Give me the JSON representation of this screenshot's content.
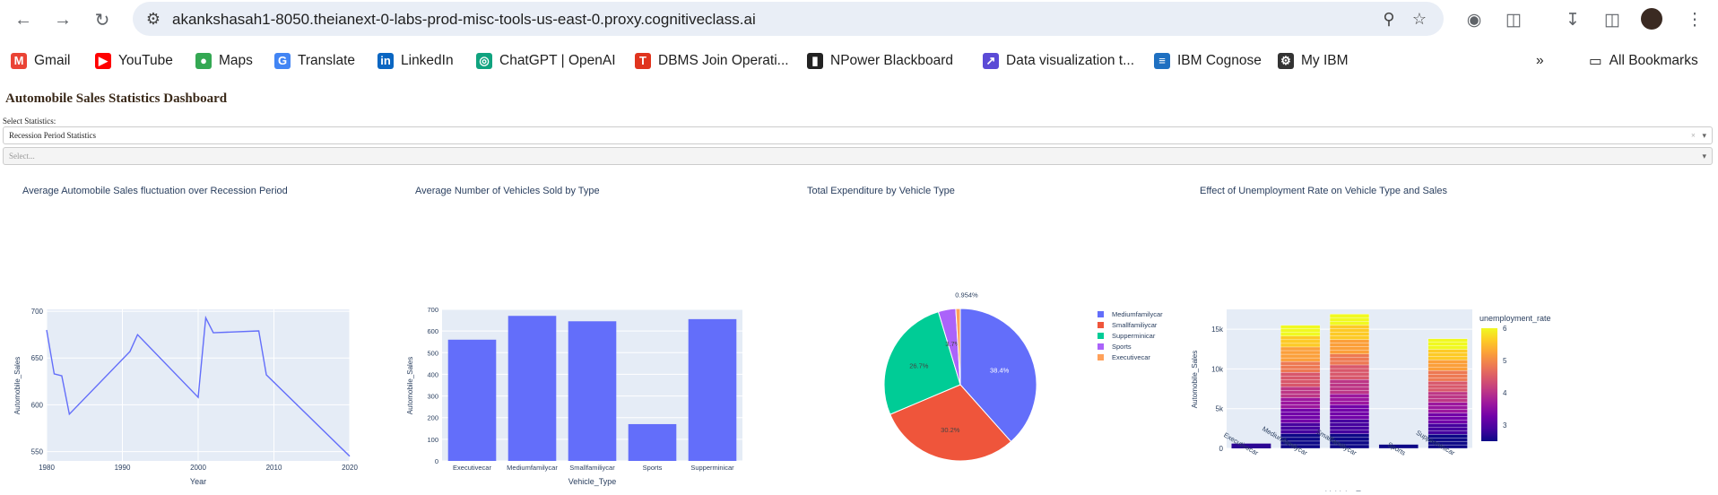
{
  "browser": {
    "url": "akankshasah1-8050.theianext-0-labs-prod-misc-tools-us-east-0.proxy.cognitiveclass.ai",
    "bookmarks": [
      {
        "label": "Gmail",
        "icon": "gmail-icon",
        "color": "#ea4335"
      },
      {
        "label": "YouTube",
        "icon": "youtube-icon",
        "color": "#ff0000"
      },
      {
        "label": "Maps",
        "icon": "maps-icon",
        "color": "#34a853"
      },
      {
        "label": "Translate",
        "icon": "translate-icon",
        "color": "#4285f4"
      },
      {
        "label": "LinkedIn",
        "icon": "linkedin-icon",
        "color": "#0a66c2"
      },
      {
        "label": "ChatGPT | OpenAI",
        "icon": "chatgpt-icon",
        "color": "#10a37f"
      },
      {
        "label": "DBMS Join Operati...",
        "icon": "dbms-icon",
        "color": "#e0341e"
      },
      {
        "label": "NPower Blackboard",
        "icon": "npower-icon",
        "color": "#222222"
      },
      {
        "label": "Data visualization t...",
        "icon": "dataviz-icon",
        "color": "#5b4bd6"
      },
      {
        "label": "IBM Cognose",
        "icon": "ibm-cognose-icon",
        "color": "#1f70c1"
      },
      {
        "label": "My IBM",
        "icon": "my-ibm-icon",
        "color": "#333333"
      }
    ],
    "all_bookmarks": "All Bookmarks",
    "more_bookmarks": "»"
  },
  "dashboard": {
    "title": "Automobile Sales Statistics Dashboard",
    "select_label": "Select Statistics:",
    "select_value": "Recession Period Statistics",
    "year_placeholder": "Select..."
  },
  "charts": {
    "line": {
      "title": "Average Automobile Sales fluctuation over Recession Period",
      "xlabel": "Year",
      "ylabel": "Automobile_Sales",
      "xticks": [
        "1980",
        "1990",
        "2000",
        "2010",
        "2020"
      ],
      "yticks": [
        "550",
        "600",
        "650",
        "700"
      ]
    },
    "bar": {
      "title": "Average Number of Vehicles Sold by Type",
      "xlabel": "Vehicle_Type",
      "ylabel": "Automobile_Sales",
      "yticks": [
        "0",
        "100",
        "200",
        "300",
        "400",
        "500",
        "600",
        "700"
      ]
    },
    "pie": {
      "title": "Total Expenditure by Vehicle Type",
      "labels": [
        "38.4%",
        "30.2%",
        "26.7%",
        "3.7%",
        "0.954%"
      ]
    },
    "stacked": {
      "title": "Effect of Unemployment Rate on Vehicle Type and Sales",
      "xlabel": "Vehicle_Type",
      "ylabel": "Automobile_Sales",
      "yticks": [
        "0",
        "5k",
        "10k",
        "15k"
      ],
      "colorbar_title": "unemployment_rate",
      "colorbar_ticks": [
        "3",
        "4",
        "5",
        "6"
      ]
    }
  },
  "chart_data": [
    {
      "type": "line",
      "title": "Average Automobile Sales fluctuation over Recession Period",
      "xlabel": "Year",
      "ylabel": "Automobile_Sales",
      "x": [
        1980,
        1981,
        1982,
        1983,
        1991,
        1992,
        2000,
        2001,
        2002,
        2008,
        2009,
        2020
      ],
      "y": [
        680,
        633,
        631,
        590,
        657,
        675,
        608,
        693,
        677,
        679,
        632,
        545
      ],
      "xlim": [
        1980,
        2020
      ],
      "ylim": [
        540,
        702
      ]
    },
    {
      "type": "bar",
      "title": "Average Number of Vehicles Sold by Type",
      "xlabel": "Vehicle_Type",
      "ylabel": "Automobile_Sales",
      "categories": [
        "Executivecar",
        "Mediumfamilycar",
        "Smallfamiliycar",
        "Sports",
        "Supperminicar"
      ],
      "values": [
        560,
        670,
        645,
        170,
        655
      ],
      "ylim": [
        0,
        700
      ]
    },
    {
      "type": "pie",
      "title": "Total Expenditure by Vehicle Type",
      "categories": [
        "Mediumfamilycar",
        "Smallfamiliycar",
        "Supperminicar",
        "Sports",
        "Executivecar"
      ],
      "values": [
        38.4,
        30.2,
        26.7,
        3.7,
        0.954
      ],
      "colors": [
        "#636efa",
        "#ef553b",
        "#00cc96",
        "#ab63fa",
        "#ffa15a"
      ],
      "legend": "right"
    },
    {
      "type": "bar",
      "title": "Effect of Unemployment Rate on Vehicle Type and Sales",
      "xlabel": "Vehicle_Type",
      "ylabel": "Automobile_Sales",
      "categories": [
        "Executivecar",
        "Mediumfamilycar",
        "Smallfamiliycar",
        "Sports",
        "Supperminicar"
      ],
      "values": [
        600,
        15500,
        16900,
        500,
        13800
      ],
      "ylim": [
        0,
        17500
      ],
      "colorbar": {
        "title": "unemployment_rate",
        "range": [
          2.5,
          6
        ]
      }
    }
  ]
}
